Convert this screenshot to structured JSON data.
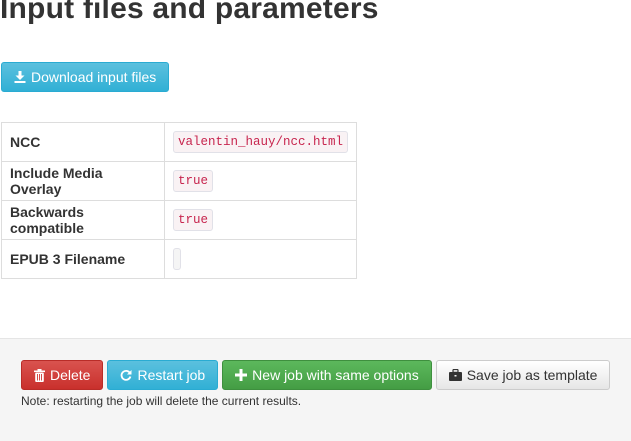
{
  "header": {
    "title": "Input files and parameters"
  },
  "download": {
    "label": "Download input files",
    "icon": "download-icon"
  },
  "parameters": [
    {
      "key": "NCC",
      "value": "valentin_hauy/ncc.html"
    },
    {
      "key": "Include Media Overlay",
      "value": "true"
    },
    {
      "key": "Backwards compatible",
      "value": "true"
    },
    {
      "key": "EPUB 3 Filename",
      "value": ""
    }
  ],
  "footer": {
    "delete_label": "Delete",
    "delete_icon": "trash-icon",
    "restart_label": "Restart job",
    "restart_icon": "refresh-icon",
    "new_job_label": "New job with same options",
    "new_job_icon": "plus-icon",
    "save_template_label": "Save job as template",
    "save_template_icon": "briefcase-icon",
    "note": "Note: restarting the job will delete the current results."
  },
  "colors": {
    "info": "#5bc0de",
    "danger": "#d9534f",
    "success": "#5cb85c",
    "code_text": "#c7254e"
  }
}
